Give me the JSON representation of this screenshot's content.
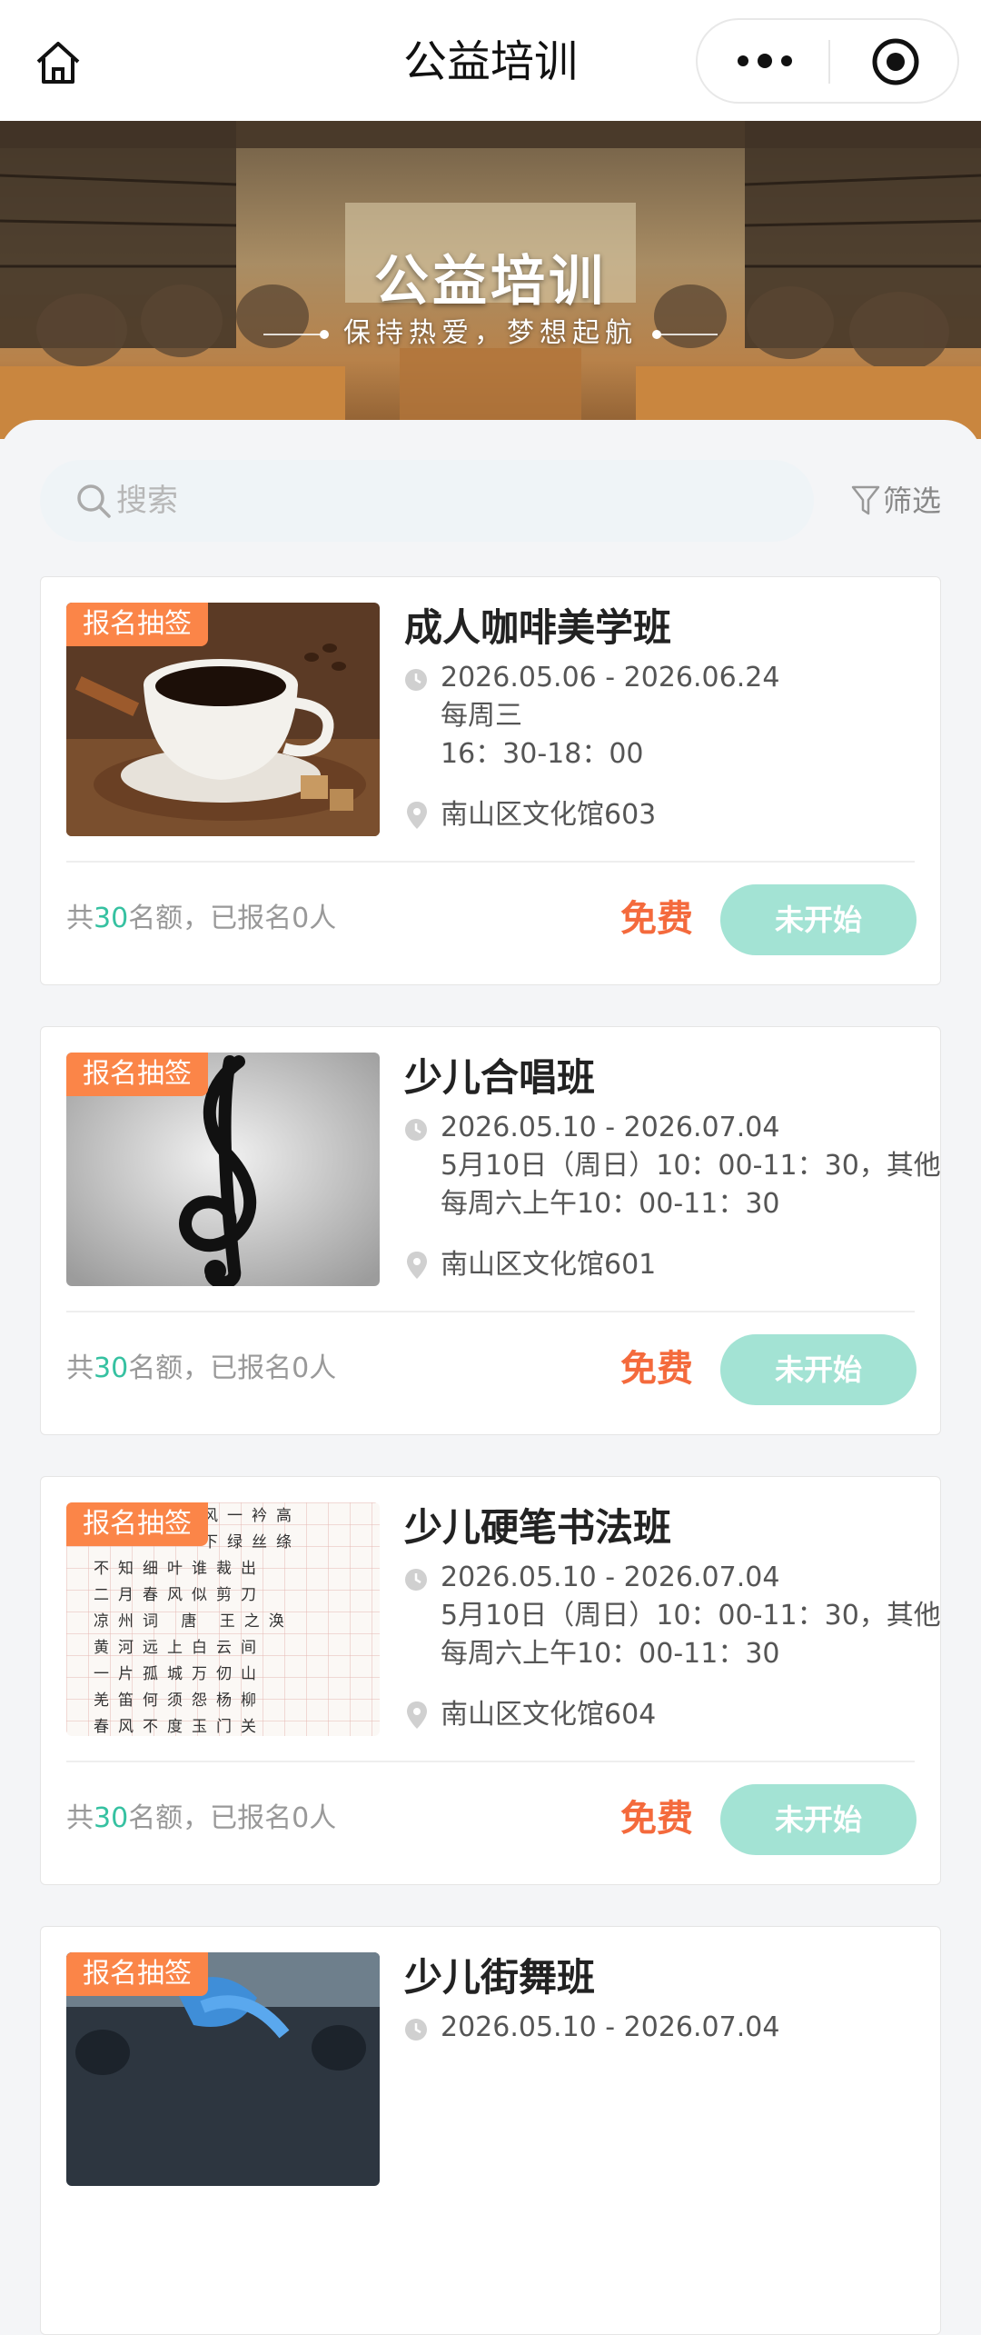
{
  "nav": {
    "title": "公益培训"
  },
  "banner": {
    "title": "公益培训",
    "subtitle": "保持热爱，梦想起航"
  },
  "search": {
    "placeholder": "搜索",
    "filter_label": "筛选"
  },
  "courses": [
    {
      "tag": "报名抽签",
      "title": "成人咖啡美学班",
      "date_range": "2026.05.06 - 2026.06.24",
      "schedule_1": "每周三",
      "schedule_2": "16：30-18：00",
      "location": "南山区文化馆603",
      "quota_prefix": "共",
      "quota_num": "30",
      "quota_suffix": "名额，已报名0人",
      "price": "免费",
      "status": "未开始",
      "thumb_icon": "coffee-cup-image"
    },
    {
      "tag": "报名抽签",
      "title": "少儿合唱班",
      "date_range": "2026.05.10 - 2026.07.04",
      "schedule_1": "5月10日（周日）10：00-11：30，其他",
      "schedule_2": "每周六上午10：00-11：30",
      "location": "南山区文化馆601",
      "quota_prefix": "共",
      "quota_num": "30",
      "quota_suffix": "名额，已报名0人",
      "price": "免费",
      "status": "未开始",
      "thumb_icon": "treble-clef-image"
    },
    {
      "tag": "报名抽签",
      "title": "少儿硬笔书法班",
      "date_range": "2026.05.10 - 2026.07.04",
      "schedule_1": "5月10日（周日）10：00-11：30，其他",
      "schedule_2": "每周六上午10：00-11：30",
      "location": "南山区文化馆604",
      "quota_prefix": "共",
      "quota_num": "30",
      "quota_suffix": "名额，已报名0人",
      "price": "免费",
      "status": "未开始",
      "thumb_icon": "calligraphy-grid-image"
    },
    {
      "tag": "报名抽签",
      "title": "少儿街舞班",
      "date_range": "2026.05.10 - 2026.07.04",
      "thumb_icon": "street-dance-image"
    }
  ],
  "calligraphy_chars": [
    "风一衿高",
    "下绿丝绦",
    "不知细叶谁裁出",
    "二月春风似剪刀",
    "凉州词 唐 王之涣",
    "黄河远上白云间",
    "一片孤城万仞山",
    "羌笛何须怨杨柳",
    "春风不度玉门关"
  ],
  "colors": {
    "accent": "#36c1a1",
    "price": "#f46a3c",
    "tag": "#fb8548",
    "status_button": "#a3e3d4"
  }
}
